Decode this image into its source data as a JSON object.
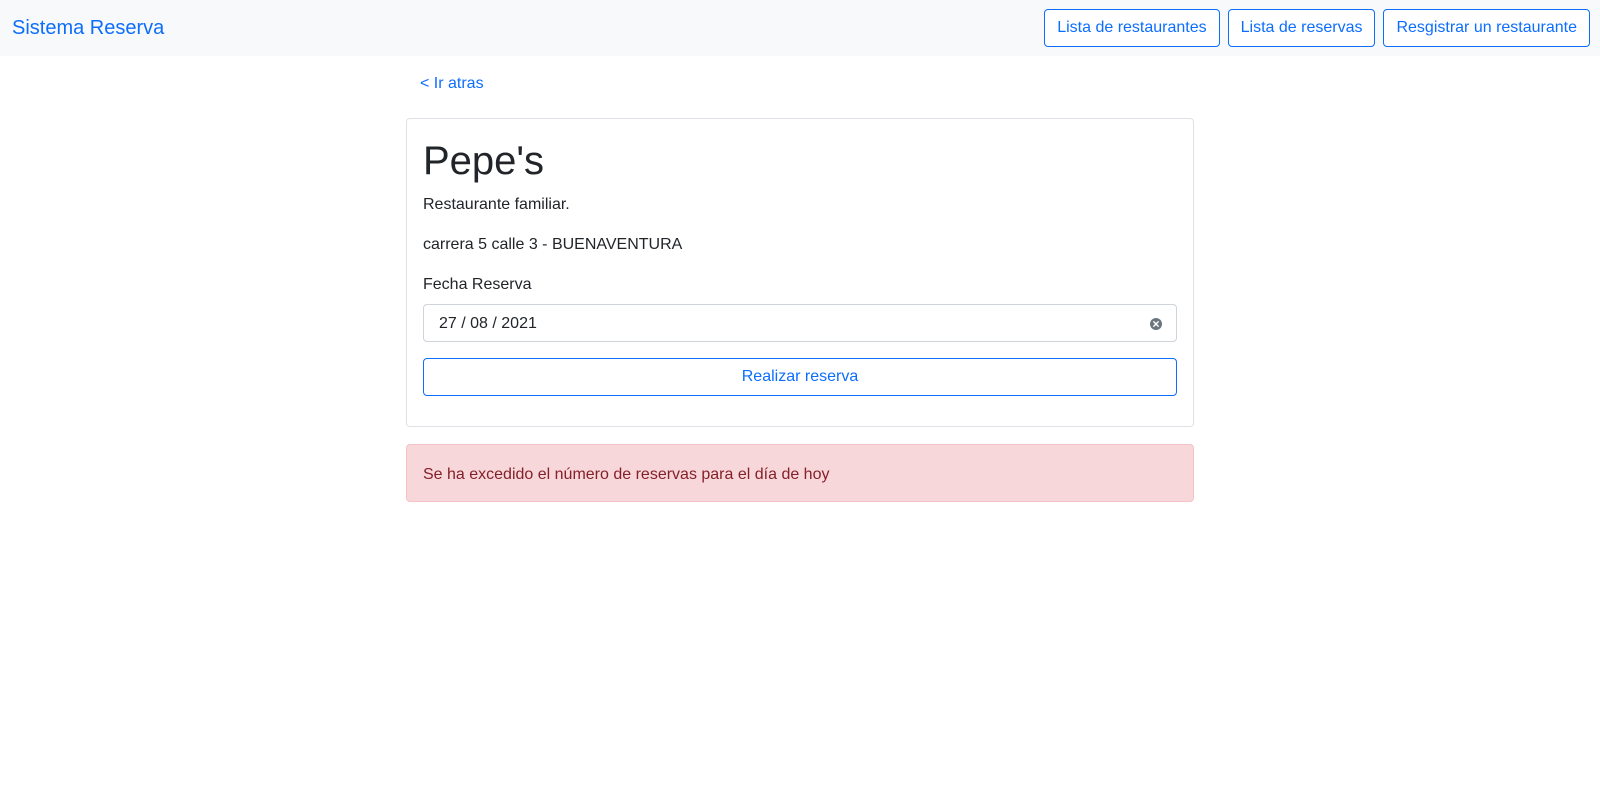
{
  "navbar": {
    "brand": "Sistema Reserva",
    "buttons": {
      "restaurants": "Lista de restaurantes",
      "reservations": "Lista de reservas",
      "register": "Resgistrar un restaurante"
    }
  },
  "back_link": "< Ir atras",
  "restaurant": {
    "name": "Pepe's",
    "description": "Restaurante familiar.",
    "address": "carrera 5 calle 3 - BUENAVENTURA"
  },
  "reservation_form": {
    "date_label": "Fecha Reserva",
    "date_value": "27 / 08 / 2021",
    "submit_label": "Realizar reserva"
  },
  "alert": {
    "message": "Se ha excedido el número de reservas para el día de hoy",
    "color": "#842029",
    "background": "#f8d7da"
  },
  "colors": {
    "primary": "#0d6efd",
    "navbar_bg": "#f8f9fa"
  },
  "icons": {
    "clear": "clear-icon"
  }
}
